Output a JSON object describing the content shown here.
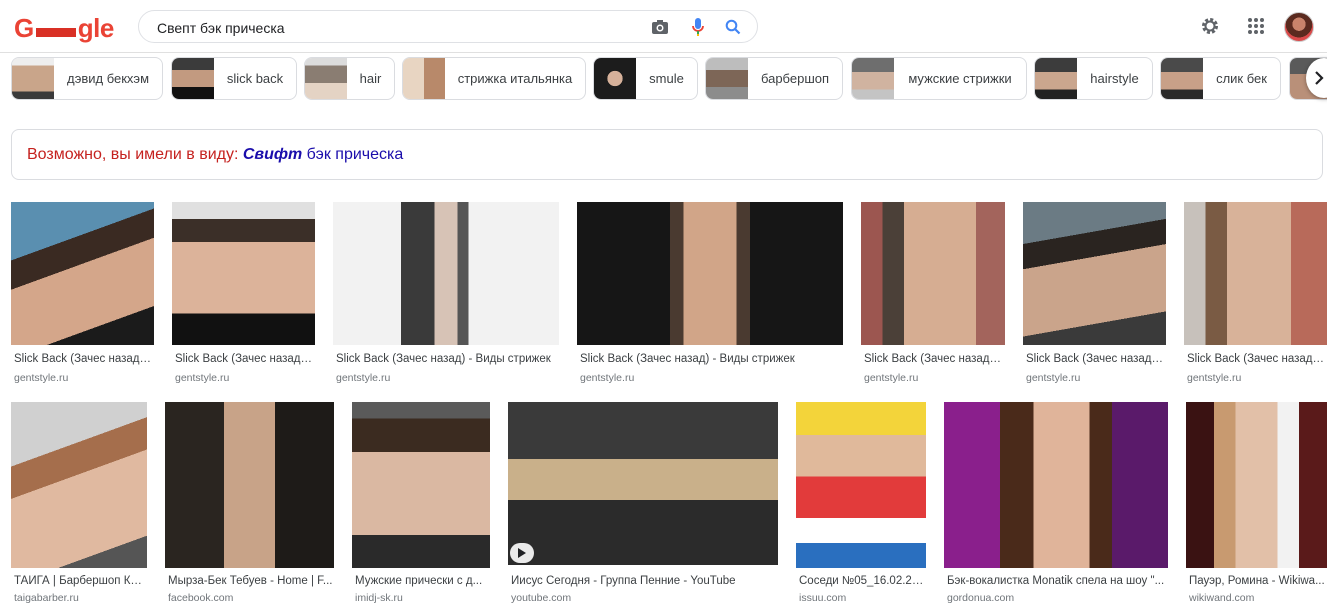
{
  "header": {
    "logo_text_start": "G",
    "logo_text_end": "gle",
    "search_value": "Свепт бэк прическа",
    "icons": {
      "camera": "camera-icon",
      "mic": "microphone-icon",
      "search": "search-icon",
      "settings": "gear-icon",
      "apps": "apps-grid-icon",
      "account": "account-avatar"
    }
  },
  "chips": [
    {
      "label": "дэвид бекхэм",
      "thumb": "#c9a58a"
    },
    {
      "label": "slick back",
      "thumb": "#2a2a2a"
    },
    {
      "label": "hair",
      "thumb": "#8a7d72"
    },
    {
      "label": "стрижка итальянка",
      "thumb": "#b8896a"
    },
    {
      "label": "smule",
      "thumb": "#1c1c1c"
    },
    {
      "label": "барбершоп",
      "thumb": "#8c8c8c"
    },
    {
      "label": "мужские стрижки",
      "thumb": "#6e6e6e"
    },
    {
      "label": "hairstyle",
      "thumb": "#3c3c3c"
    },
    {
      "label": "слик бек",
      "thumb": "#4a4a4a"
    },
    {
      "label": "",
      "thumb": "#5a5a5a"
    }
  ],
  "suggestion": {
    "prefix": "Возможно, вы имели в виду: ",
    "emph": "Свифт",
    "rest": " бэк прическа"
  },
  "results": [
    {
      "title": "Slick Back (Зачес назад) ...",
      "source": "gentstyle.ru",
      "bg": "#3a6f8e"
    },
    {
      "title": "Slick Back (Зачес назад) ...",
      "source": "gentstyle.ru",
      "bg": "#d9d9d9"
    },
    {
      "title": "Slick Back (Зачес назад) - Виды стрижек",
      "source": "gentstyle.ru",
      "bg": "#f0f0f0"
    },
    {
      "title": "Slick Back (Зачес назад) - Виды стрижек",
      "source": "gentstyle.ru",
      "bg": "#1a1a1a"
    },
    {
      "title": "Slick Back (Зачес назад) ...",
      "source": "gentstyle.ru",
      "bg": "#a0605a"
    },
    {
      "title": "Slick Back (Зачес назад) ...",
      "source": "gentstyle.ru",
      "bg": "#5b6b74"
    },
    {
      "title": "Slick Back (Зачес назад) ...",
      "source": "gentstyle.ru",
      "bg": "#c8c2bc"
    },
    {
      "title": "ТАЙГА | Барбершоп Кр...",
      "source": "taigabarber.ru",
      "bg": "#cfcfcf"
    },
    {
      "title": "Мырза-Бек Тебуев - Home | F...",
      "source": "facebook.com",
      "bg": "#1e1b18"
    },
    {
      "title": "Мужские прически с д...",
      "source": "imidj-sk.ru",
      "bg": "#4a4a4a"
    },
    {
      "title": "Иисус Сегодня - Группа Пенние - YouTube",
      "source": "youtube.com",
      "bg": "#2b2b2b"
    },
    {
      "title": "Соседи №05_16.02.20...",
      "source": "issuu.com",
      "bg": "#f3d43a"
    },
    {
      "title": "Бэк-вокалистка Monatik спела на шоу \"...",
      "source": "gordonua.com",
      "bg": "#7a1c7a"
    },
    {
      "title": "Пауэр, Ромина - Wikiwa...",
      "source": "wikiwand.com",
      "bg": "#4a1a1a"
    }
  ]
}
